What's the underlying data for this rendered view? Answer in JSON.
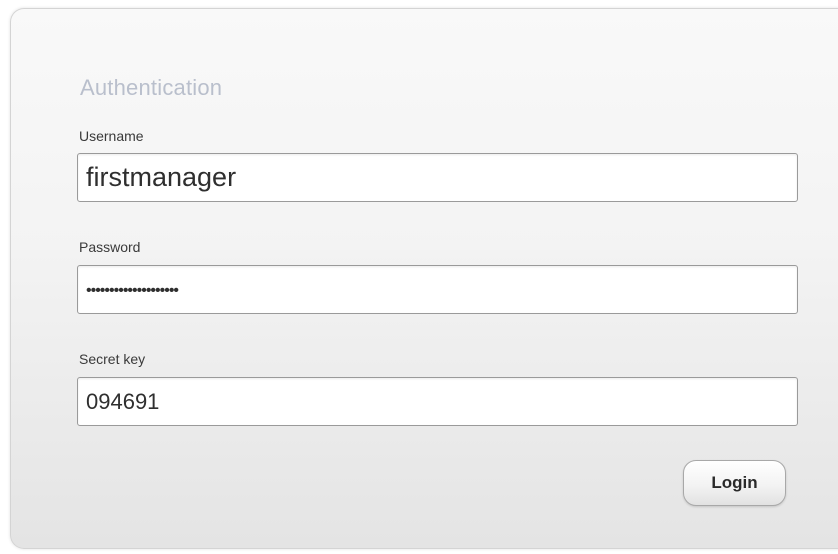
{
  "auth": {
    "title": "Authentication",
    "username": {
      "label": "Username",
      "value": "firstmanager"
    },
    "password": {
      "label": "Password",
      "masked_value": "••••••••••••••••••••"
    },
    "secret_key": {
      "label": "Secret key",
      "value": "094691"
    },
    "login_label": "Login"
  }
}
